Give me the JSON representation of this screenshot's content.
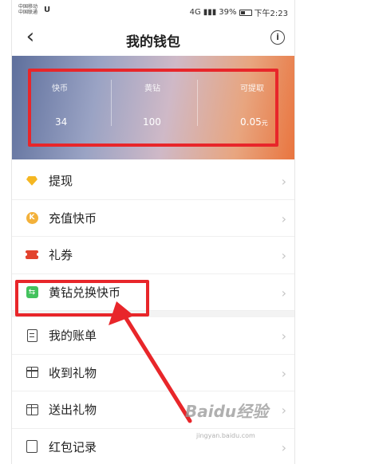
{
  "status_bar": {
    "carrier_1": "中国移动",
    "carrier_2": "中国联通",
    "carrier_logo": "U",
    "network": "4G",
    "battery": "39%",
    "time": "下午2:23"
  },
  "nav": {
    "title": "我的钱包",
    "back_icon": "‹",
    "info_icon": "i"
  },
  "balances": [
    {
      "label": "快币",
      "value": "34",
      "unit": ""
    },
    {
      "label": "黄钻",
      "value": "100",
      "unit": ""
    },
    {
      "label": "可提取",
      "value": "0.05",
      "unit": "元"
    }
  ],
  "menu": {
    "group1": [
      {
        "label": "提现",
        "icon": "diamond-icon"
      },
      {
        "label": "充值快币",
        "icon": "coin-icon"
      },
      {
        "label": "礼券",
        "icon": "ticket-icon"
      },
      {
        "label": "黄钻兑换快币",
        "icon": "exchange-icon"
      }
    ],
    "group2": [
      {
        "label": "我的账单",
        "icon": "bill-icon"
      },
      {
        "label": "收到礼物",
        "icon": "gift-icon"
      },
      {
        "label": "送出礼物",
        "icon": "gift-icon"
      },
      {
        "label": "红包记录",
        "icon": "envelope-icon"
      }
    ],
    "chevron": "›"
  },
  "icons": {
    "coin_glyph": "K",
    "exchange_glyph": "⇆"
  },
  "watermark": {
    "brand": "Baidu经验",
    "url": "jingyan.baidu.com"
  },
  "colors": {
    "highlight": "#e8262a",
    "banner_start": "#5e6f9c",
    "banner_end": "#e9753f",
    "diamond": "#f5b722",
    "coin": "#f3b13a",
    "ticket": "#e2432e",
    "exchange": "#43c25d"
  }
}
